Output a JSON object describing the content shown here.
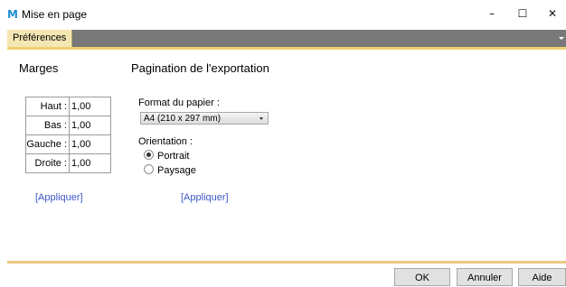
{
  "window": {
    "app_icon_glyph": "M",
    "title": "Mise en page",
    "controls": {
      "minimize": "–",
      "maximize": "☐",
      "close": "✕"
    }
  },
  "tabs": [
    {
      "label": "Préférences",
      "active": true
    }
  ],
  "margins": {
    "heading": "Marges",
    "rows": [
      {
        "label": "Haut :",
        "value": "1,00"
      },
      {
        "label": "Bas :",
        "value": "1,00"
      },
      {
        "label": "Gauche :",
        "value": "1,00"
      },
      {
        "label": "Droite :",
        "value": "1,00"
      }
    ],
    "apply_link": "[Appliquer]"
  },
  "pagination": {
    "heading": "Pagination de l'exportation",
    "paper_format_label": "Format du papier :",
    "paper_format_value": "A4 (210 x 297 mm)",
    "orientation_label": "Orientation :",
    "orientation_options": [
      {
        "label": "Portrait",
        "selected": true
      },
      {
        "label": "Paysage",
        "selected": false
      }
    ],
    "apply_link": "[Appliquer]"
  },
  "footer": {
    "ok": "OK",
    "cancel": "Annuler",
    "help": "Aide"
  },
  "colors": {
    "tab_bg": "#f5e7b3",
    "tabbar_bg": "#787878",
    "accent": "#f0cf6e",
    "link": "#3d57c8",
    "app_icon": "#1f8fd6"
  }
}
